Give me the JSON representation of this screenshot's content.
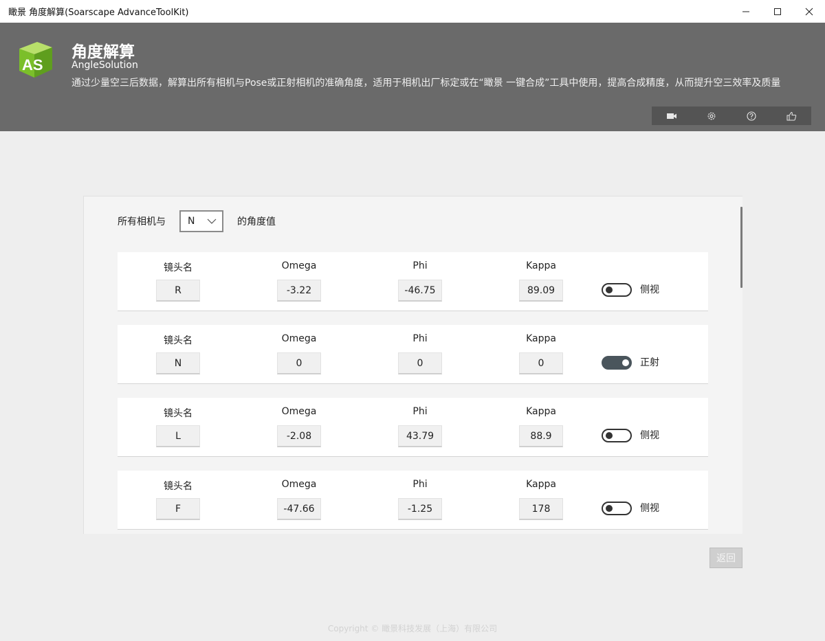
{
  "window": {
    "title": "瞰景 角度解算(Soarscape AdvanceToolKit)",
    "controls": [
      "minimize-icon",
      "maximize-icon",
      "close-icon"
    ]
  },
  "header": {
    "logo_text": "AS",
    "title": "角度解算",
    "subtitle": "AngleSolution",
    "description": "通过少量空三后数据，解算出所有相机与Pose或正射相机的准确角度，适用于相机出厂标定或在“瞰景 一键合成”工具中使用，提高合成精度，从而提升空三效率及质量",
    "toolbar": [
      "video-camera-icon",
      "gear-icon",
      "help-icon",
      "thumbs-up-icon"
    ]
  },
  "selector": {
    "prefix": "所有相机与",
    "selected": "N",
    "suffix": "的角度值"
  },
  "columns": {
    "lens": "镜头名",
    "omega": "Omega",
    "phi": "Phi",
    "kappa": "Kappa"
  },
  "cameras": [
    {
      "lens": "R",
      "omega": "-3.22",
      "phi": "-46.75",
      "kappa": "89.09",
      "toggle_on": false,
      "mode": "侧视"
    },
    {
      "lens": "N",
      "omega": "0",
      "phi": "0",
      "kappa": "0",
      "toggle_on": true,
      "mode": "正射"
    },
    {
      "lens": "L",
      "omega": "-2.08",
      "phi": "43.79",
      "kappa": "88.9",
      "toggle_on": false,
      "mode": "侧视"
    },
    {
      "lens": "F",
      "omega": "-47.66",
      "phi": "-1.25",
      "kappa": "178",
      "toggle_on": false,
      "mode": "侧视"
    }
  ],
  "back_button": "返回",
  "copyright": "Copyright © 瞰景科技发展（上海）有限公司",
  "colors": {
    "header_bg": "#6a6a6a",
    "logo_green": "#8cc63f",
    "toggle_on": "#4a555c"
  }
}
